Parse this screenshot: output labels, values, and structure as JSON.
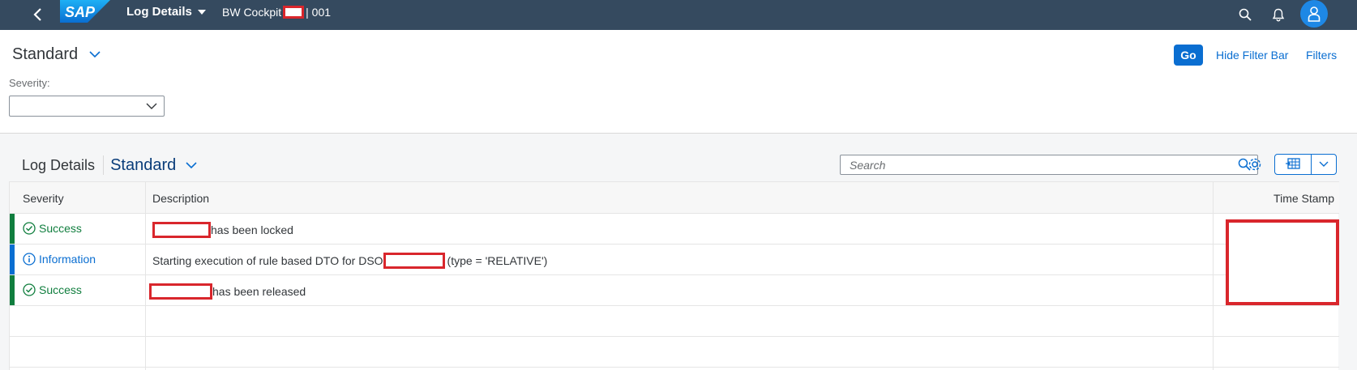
{
  "shell": {
    "app_title": "Log Details",
    "subtitle_left": "BW Cockpit",
    "subtitle_right": "| 001"
  },
  "filter_bar": {
    "variant": "Standard",
    "severity_label": "Severity:",
    "severity_value": "",
    "go_label": "Go",
    "hide_label": "Hide Filter Bar",
    "filters_label": "Filters"
  },
  "table": {
    "title": "Log Details",
    "variant": "Standard",
    "search_placeholder": "Search",
    "columns": [
      "Severity",
      "Description",
      "Time Stamp"
    ],
    "rows": [
      {
        "severity": "Success",
        "desc_before": "",
        "desc_after": "has been locked",
        "color": "#107e3e"
      },
      {
        "severity": "Information",
        "desc_before": "Starting execution of rule based DTO for DSO",
        "desc_after": "(type = 'RELATIVE')",
        "color": "#0a6ed1"
      },
      {
        "severity": "Success",
        "desc_before": "",
        "desc_after": "has been released",
        "color": "#107e3e"
      }
    ]
  },
  "colors": {
    "shell": "#354a5f",
    "accent": "#0a6ed1",
    "success": "#107e3e",
    "redaction": "#d9262c"
  }
}
